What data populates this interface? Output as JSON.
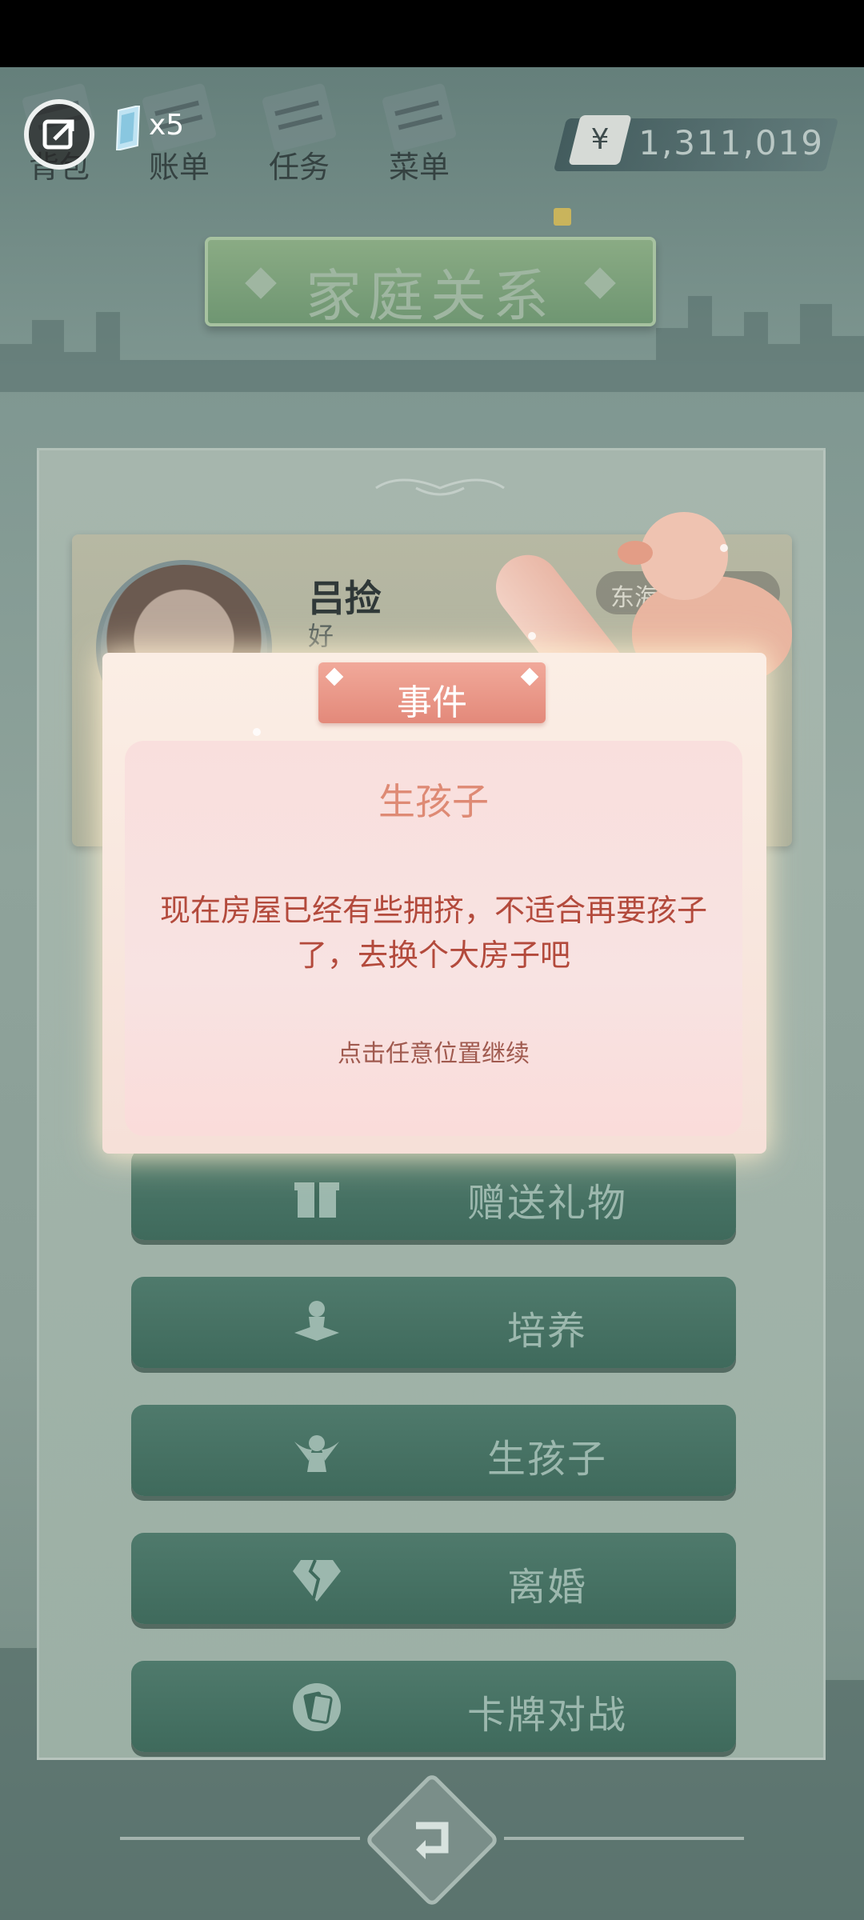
{
  "top_bar": {
    "nav": [
      {
        "label": "背包",
        "icon": "bag-icon"
      },
      {
        "label": "账单",
        "icon": "bill-icon"
      },
      {
        "label": "任务",
        "icon": "task-icon"
      },
      {
        "label": "菜单",
        "icon": "menu-icon"
      }
    ],
    "gem_count": "x5",
    "currency_symbol": "¥",
    "money": "1,311,019"
  },
  "header": {
    "title": "家庭关系"
  },
  "profile": {
    "name": "吕捡",
    "subtitle": "好",
    "location": "东海珠市"
  },
  "actions": [
    {
      "label": "赠送礼物",
      "icon": "gift-icon"
    },
    {
      "label": "培养",
      "icon": "reading-person-icon"
    },
    {
      "label": "生孩子",
      "icon": "angel-icon"
    },
    {
      "label": "离婚",
      "icon": "broken-diamond-icon"
    },
    {
      "label": "卡牌对战",
      "icon": "card-battle-icon"
    }
  ],
  "modal": {
    "tab_label": "事件",
    "title": "生孩子",
    "message": "现在房屋已经有些拥挤，不适合再要孩子了，去换个大房子吧",
    "hint": "点击任意位置继续"
  },
  "colors": {
    "action_button": "#3f6a5c",
    "modal_tab": "#e3897a",
    "modal_title": "#de8a74",
    "modal_text": "#b34a3c"
  }
}
